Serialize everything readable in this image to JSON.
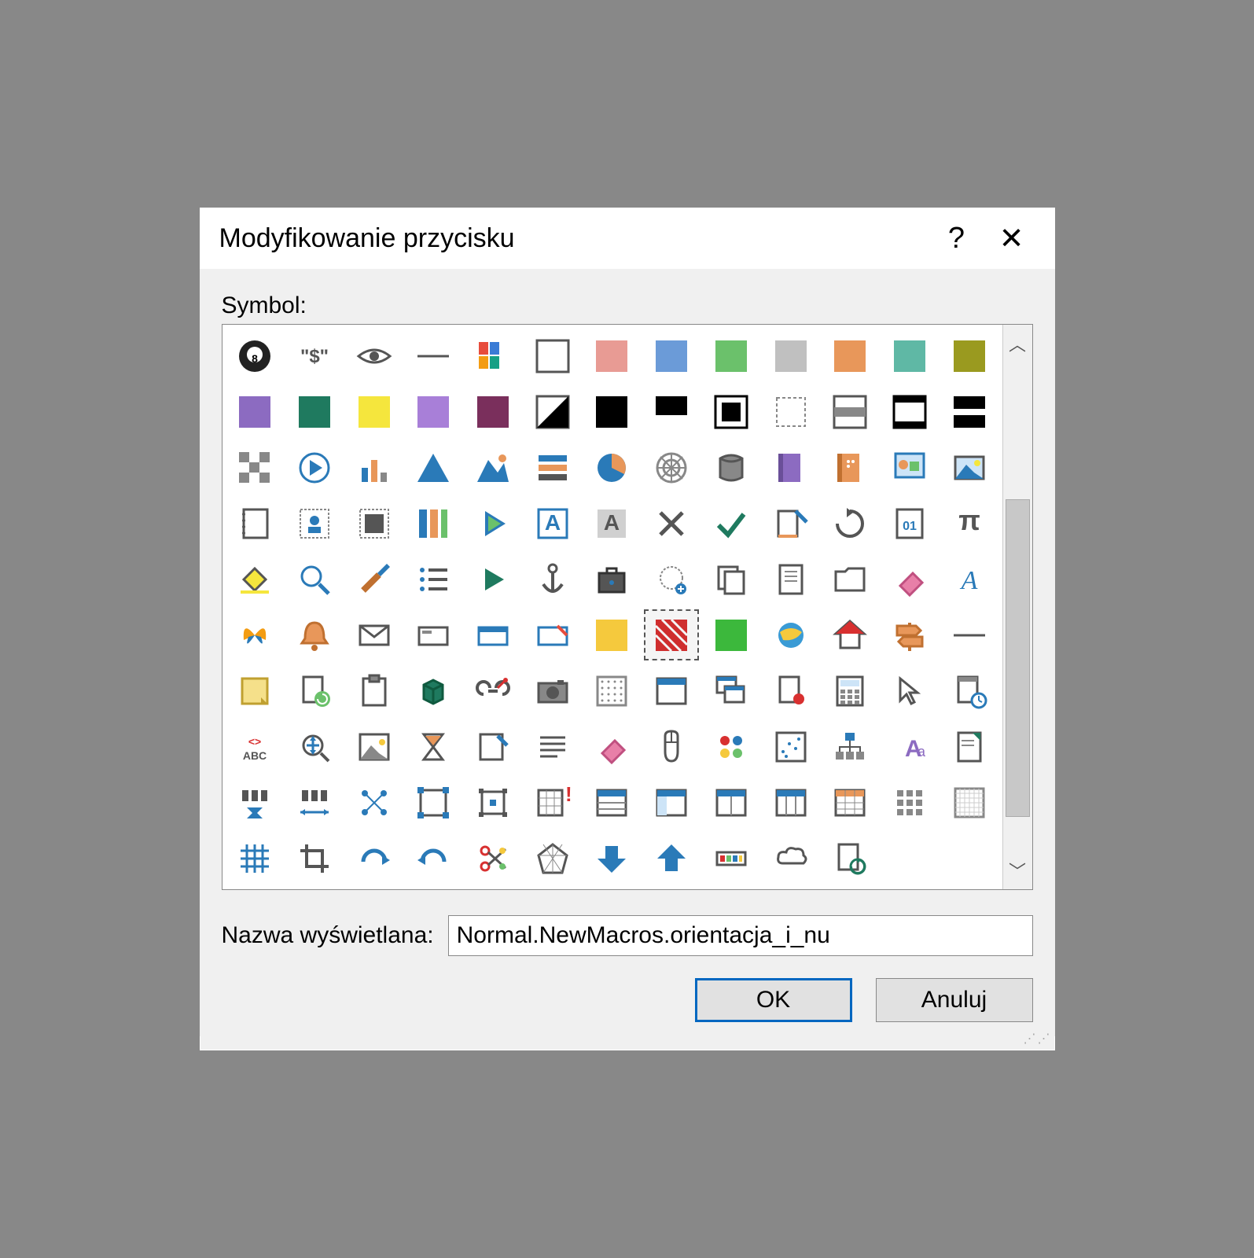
{
  "title": "Modyfikowanie przycisku",
  "labels": {
    "symbol": "Symbol:",
    "display_name": "Nazwa wyświetlana:"
  },
  "display_name_value": "Normal.NewMacros.orientacja_i_nu",
  "buttons": {
    "ok": "OK",
    "cancel": "Anuluj"
  },
  "icons": [
    "eight-ball",
    "dollar-quote",
    "eye",
    "line",
    "color-grid",
    "white-sq",
    "salmon-sq",
    "blue-sq",
    "green-sq",
    "gray-sq",
    "orange-sq",
    "teal-sq",
    "olive-sq",
    "purple-sq",
    "darkgreen-sq",
    "yellow-sq",
    "violet-sq",
    "plum-sq",
    "diag-split",
    "black-sq",
    "white-bottom",
    "white-border",
    "dotted-border",
    "gray-stripe",
    "white-frame",
    "black-stripe",
    "checker",
    "arrow-circle",
    "bar-chart",
    "triangle",
    "mountain",
    "stack-bars",
    "pie",
    "spider",
    "database",
    "book-purple",
    "book-orange",
    "picture-shapes",
    "landscape",
    "notebook",
    "contact-dotted",
    "film-dotted",
    "stripes",
    "play-tri",
    "letter-a-box",
    "letter-a-gray",
    "x-mark",
    "check",
    "edit-doc",
    "refresh",
    "binary",
    "pi",
    "paint-bucket",
    "magnifier",
    "brush",
    "list",
    "play",
    "anchor",
    "briefcase",
    "dotted-plus",
    "copy",
    "page",
    "folder",
    "eraser-pink",
    "italic-a",
    "butterfly",
    "bell",
    "envelope",
    "card",
    "card-blue",
    "card-edit",
    "yellow-fill",
    "red-hatch",
    "green-fill",
    "ie",
    "home-red",
    "signpost",
    "line2",
    "note",
    "page-refresh",
    "clipboard",
    "cube",
    "link",
    "camera",
    "grid-dots",
    "window",
    "windows-cascade",
    "page-badge",
    "calculator",
    "cursor",
    "page-clock",
    "abc",
    "zoom-move",
    "picture",
    "hourglass",
    "page-pencil",
    "align-lines",
    "eraser",
    "mouse",
    "dots-color",
    "scatter",
    "org-chart",
    "font-aa",
    "sheet-green",
    "align-h",
    "align-h2",
    "nodes",
    "group",
    "group2",
    "table-alert",
    "layout1",
    "layout2",
    "layout3",
    "layout4",
    "grid-orange",
    "grid-9",
    "grid-fine",
    "hash",
    "crop",
    "redo",
    "undo",
    "scissors",
    "pentagon",
    "arrow-down",
    "arrow-up",
    "color-bar",
    "cloud",
    "page-recycle"
  ],
  "selected_index": 72
}
